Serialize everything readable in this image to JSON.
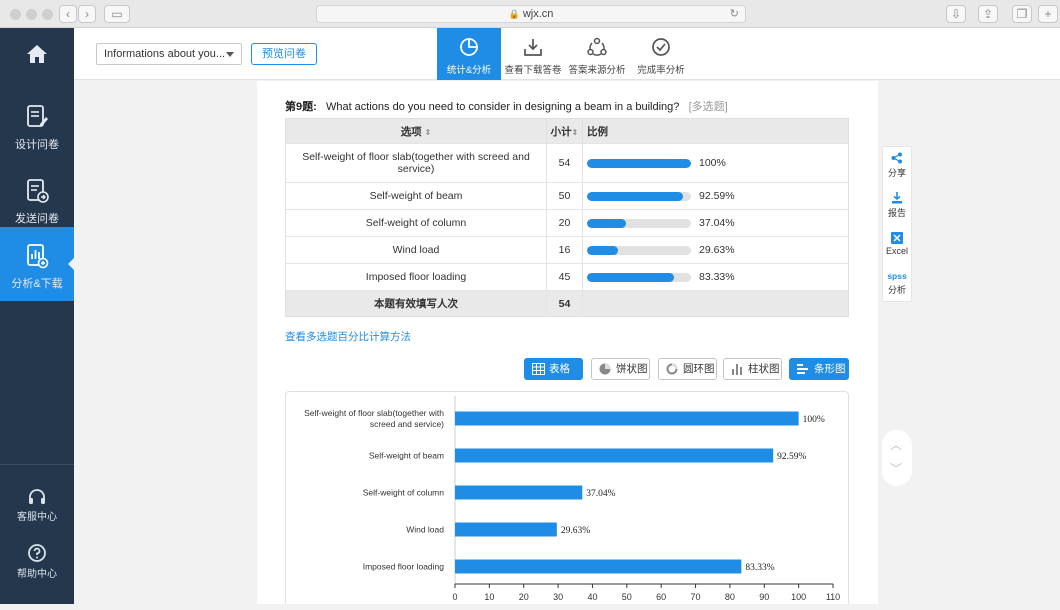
{
  "browser": {
    "url": "wjx.cn"
  },
  "sidebar": {
    "items": [
      {
        "label": "设计问卷",
        "icon": "design-icon"
      },
      {
        "label": "发送问卷",
        "icon": "send-icon"
      },
      {
        "label": "分析&下载",
        "icon": "analysis-icon",
        "active": true
      }
    ],
    "bottom": [
      {
        "label": "客服中心",
        "icon": "headset-icon"
      },
      {
        "label": "帮助中心",
        "icon": "help-icon"
      }
    ]
  },
  "toolbar": {
    "survey_select": "Informations about you...",
    "preview_label": "预览问卷",
    "tabs": [
      {
        "label": "统计&分析",
        "icon": "pie-chart-icon",
        "active": true
      },
      {
        "label": "查看下载答卷",
        "icon": "download-icon"
      },
      {
        "label": "答案来源分析",
        "icon": "source-icon"
      },
      {
        "label": "完成率分析",
        "icon": "check-circle-icon"
      }
    ]
  },
  "question": {
    "number": "第9题:",
    "text": "What actions do you need to consider in designing a beam in a building?",
    "type_tag": "[多选题]"
  },
  "table": {
    "headers": {
      "option": "选项",
      "count": "小计",
      "ratio": "比例"
    },
    "rows": [
      {
        "option": "Self-weight of floor slab(together with screed and service)",
        "count": "54",
        "ratio": "100%",
        "fraction": 1.0
      },
      {
        "option": "Self-weight of beam",
        "count": "50",
        "ratio": "92.59%",
        "fraction": 0.9259
      },
      {
        "option": "Self-weight of column",
        "count": "20",
        "ratio": "37.04%",
        "fraction": 0.3704
      },
      {
        "option": "Wind load",
        "count": "16",
        "ratio": "29.63%",
        "fraction": 0.2963
      },
      {
        "option": "Imposed floor loading",
        "count": "45",
        "ratio": "83.33%",
        "fraction": 0.8333
      }
    ],
    "total_label": "本题有效填写人次",
    "total_value": "54"
  },
  "calc_link": "查看多选题百分比计算方法",
  "view_buttons": [
    {
      "label": "表格",
      "icon": "table-icon",
      "active": true
    },
    {
      "label": "饼状图",
      "icon": "pie-icon"
    },
    {
      "label": "圆环图",
      "icon": "donut-icon"
    },
    {
      "label": "柱状图",
      "icon": "column-chart-icon"
    },
    {
      "label": "条形图",
      "icon": "bar-chart-icon",
      "active": true
    }
  ],
  "right_toolbar": [
    {
      "label": "分享",
      "icon": "share-icon"
    },
    {
      "label": "报告",
      "icon": "report-download-icon"
    },
    {
      "label": "Excel",
      "icon": "excel-icon"
    },
    {
      "label": "分析",
      "icon": "spss-icon",
      "badge": "spss"
    }
  ],
  "colors": {
    "accent": "#1f8ce6",
    "sidebar": "#24374d"
  },
  "chart_data": {
    "type": "bar",
    "orientation": "horizontal",
    "categories": [
      "Self-weight of floor slab(together with screed and service)",
      "Self-weight of beam",
      "Self-weight of column",
      "Wind load",
      "Imposed floor loading"
    ],
    "category_lines": [
      [
        "Self-weight of floor slab(together with",
        "screed and service)"
      ],
      [
        "Self-weight of beam"
      ],
      [
        "Self-weight of column"
      ],
      [
        "Wind load"
      ],
      [
        "Imposed floor loading"
      ]
    ],
    "values": [
      100,
      92.59,
      37.04,
      29.63,
      83.33
    ],
    "data_labels": [
      "100%",
      "92.59%",
      "37.04%",
      "29.63%",
      "83.33%"
    ],
    "xlim": [
      0,
      110
    ],
    "xticks": [
      0,
      10,
      20,
      30,
      40,
      50,
      60,
      70,
      80,
      90,
      100,
      110
    ],
    "color": "#1f8ce6"
  }
}
